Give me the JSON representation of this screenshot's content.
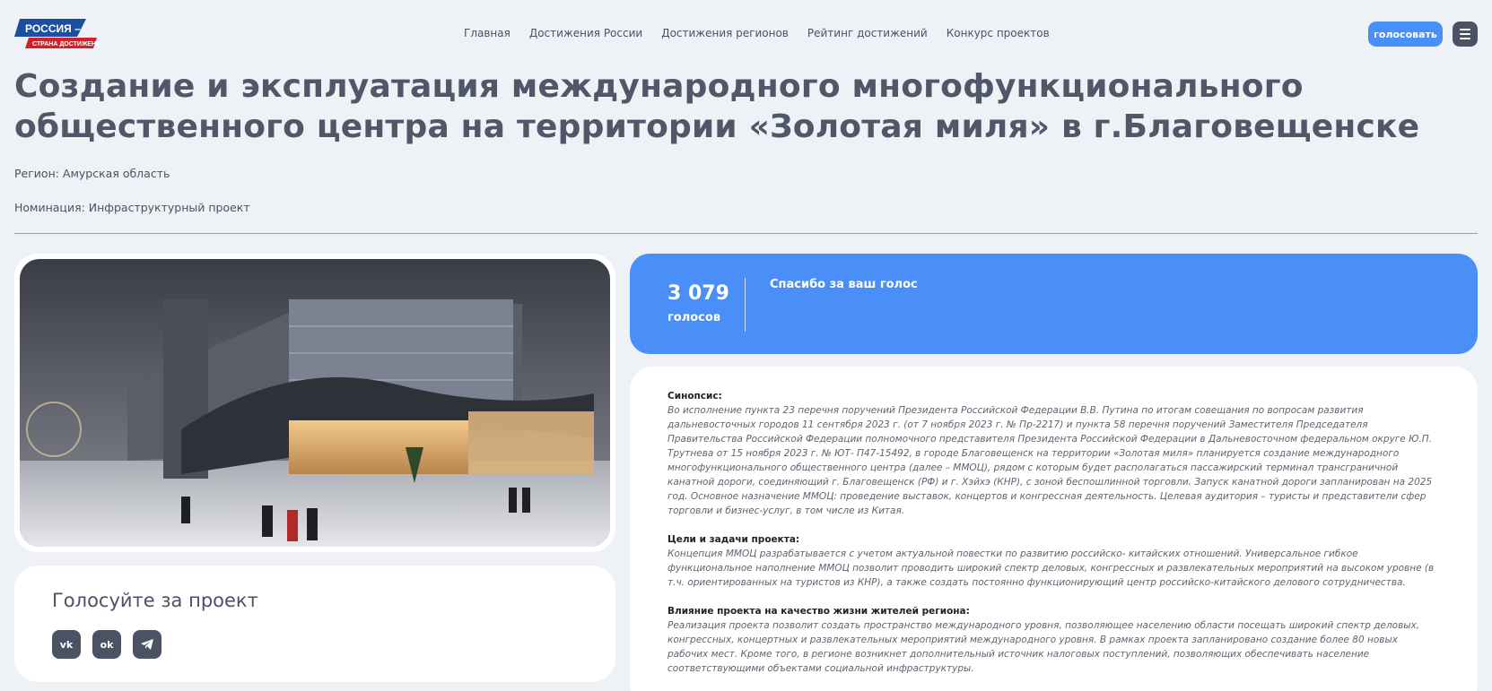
{
  "logo": {
    "line1": "РОССИЯ –",
    "line2": "СТРАНА ДОСТИЖЕНИЙ",
    "colors": {
      "blue": "#1b4fa0",
      "red": "#d5202a"
    }
  },
  "nav": {
    "items": [
      {
        "label": "Главная"
      },
      {
        "label": "Достижения России"
      },
      {
        "label": "Достижения регионов"
      },
      {
        "label": "Рейтинг достижений"
      },
      {
        "label": "Конкурс проектов"
      }
    ]
  },
  "header": {
    "vote_label": "голосовать",
    "menu_icon": "hamburger-icon"
  },
  "project": {
    "title": "Создание и эксплуатация международного многофункционального общественного центра на территории «Золотая миля» в г.Благовещенске",
    "region": "Регион: Амурская область",
    "nomination": "Номинация: Инфраструктурный проект"
  },
  "votes": {
    "count": "3 079",
    "label": "голосов",
    "thanks": "Спасибо за ваш голос"
  },
  "share": {
    "title": "Голосуйте за проект",
    "icons": [
      {
        "name": "vk-icon",
        "glyph": "vk"
      },
      {
        "name": "odnoklassniki-icon",
        "glyph": "ok"
      },
      {
        "name": "telegram-icon",
        "glyph": "tg"
      }
    ]
  },
  "description": {
    "synopsis_head": "Синопсис:",
    "synopsis": "Во исполнение пункта 23 перечня поручений Президента Российской Федерации В.В. Путина по итогам совещания по вопросам развития дальневосточных городов 11 сентября 2023 г. (от 7 ноября 2023 г. № Пр-2217) и пункта 58 перечня поручений Заместителя Председателя Правительства Российской Федерации полномочного представителя Президента Российской Федерации в Дальневосточном федеральном округе Ю.П. Трутнева от 15 ноября 2023 г. № ЮТ- П47-15492, в городе Благовещенск на территории «Золотая миля» планируется создание международного многофункционального общественного центра (далее – ММОЦ), рядом с которым будет располагаться пассажирский терминал трансграничной канатной дороги, соединяющий г. Благовещенск (РФ) и г. Хэйхэ (КНР), с зоной беспошлинной торговли. Запуск канатной дороги запланирован на 2025 год. Основное назначение ММОЦ: проведение выставок, концертов и конгрессная деятельность. Целевая аудитория – туристы и представители сфер торговли и бизнес-услуг, в том числе из Китая.",
    "goals_head": "Цели и задачи проекта:",
    "goals": "Концепция ММОЦ разрабатывается с учетом актуальной повестки по развитию российско- китайских отношений. Универсальное гибкое функциональное наполнение ММОЦ позволит проводить широкий спектр деловых, конгрессных и развлекательных мероприятий на высоком уровне (в т.ч. ориентированных на туристов из КНР), а также создать постоянно функционирующий центр российско-китайского делового сотрудничества.",
    "impact_head": "Влияние проекта на качество жизни жителей региона:",
    "impact": "Реализация проекта позволит создать пространство международного уровня, позволяющее населению области посещать широкий спектр деловых, конгрессных, концертных и развлекательных мероприятий международного уровня. В рамках проекта запланировано создание более 80 новых рабочих мест. Кроме того, в регионе возникнет дополнительный источник налоговых поступлений, позволяющих обеспечивать население соответствующими объектами социальной инфраструктуры."
  }
}
